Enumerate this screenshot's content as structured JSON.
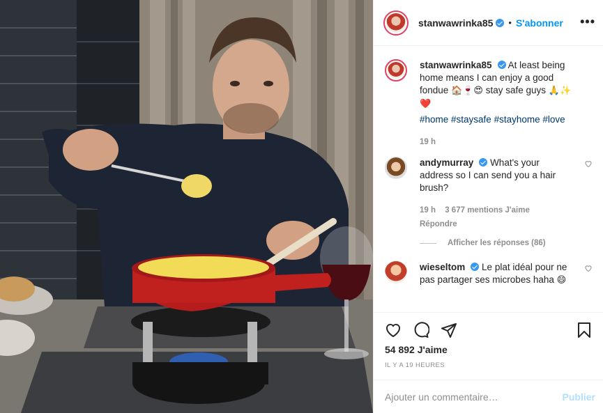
{
  "header": {
    "username": "stanwawrinka85",
    "separator": "•",
    "follow_label": "S'abonner",
    "more_label": "•••"
  },
  "caption": {
    "username": "stanwawrinka85",
    "text_part1": "At least being home means I can enjoy a good fondue ",
    "emoji1": "🏠🍷😍",
    "text_part2": " stay safe guys ",
    "emoji2": "🙏✨",
    "emoji3": "❤️",
    "hashtags": "#home #staysafe #stayhome #love",
    "time": "19 h"
  },
  "comments": [
    {
      "username": "andymurray",
      "text": "What's your address so I can send you a hair brush?",
      "time": "19 h",
      "likes": "3 677 mentions J'aime",
      "reply_label": "Répondre",
      "view_replies": "Afficher les réponses (86)"
    },
    {
      "username": "wieseltom",
      "text": "Le plat idéal pour ne pas partager ses microbes haha ",
      "emoji": "😄"
    }
  ],
  "actions": {
    "likes": "54 892 J'aime",
    "timestamp": "IL Y A 19 HEURES"
  },
  "add_comment": {
    "placeholder": "Ajouter un commentaire…",
    "publish_label": "Publier"
  },
  "colors": {
    "accent": "#0095f6",
    "verified": "#3897f0",
    "muted": "#8e8e8e",
    "text": "#262626",
    "pot": "#c0211f"
  },
  "icons": [
    "verified-icon",
    "more-icon",
    "heart-icon",
    "comment-icon",
    "share-icon",
    "bookmark-icon"
  ]
}
